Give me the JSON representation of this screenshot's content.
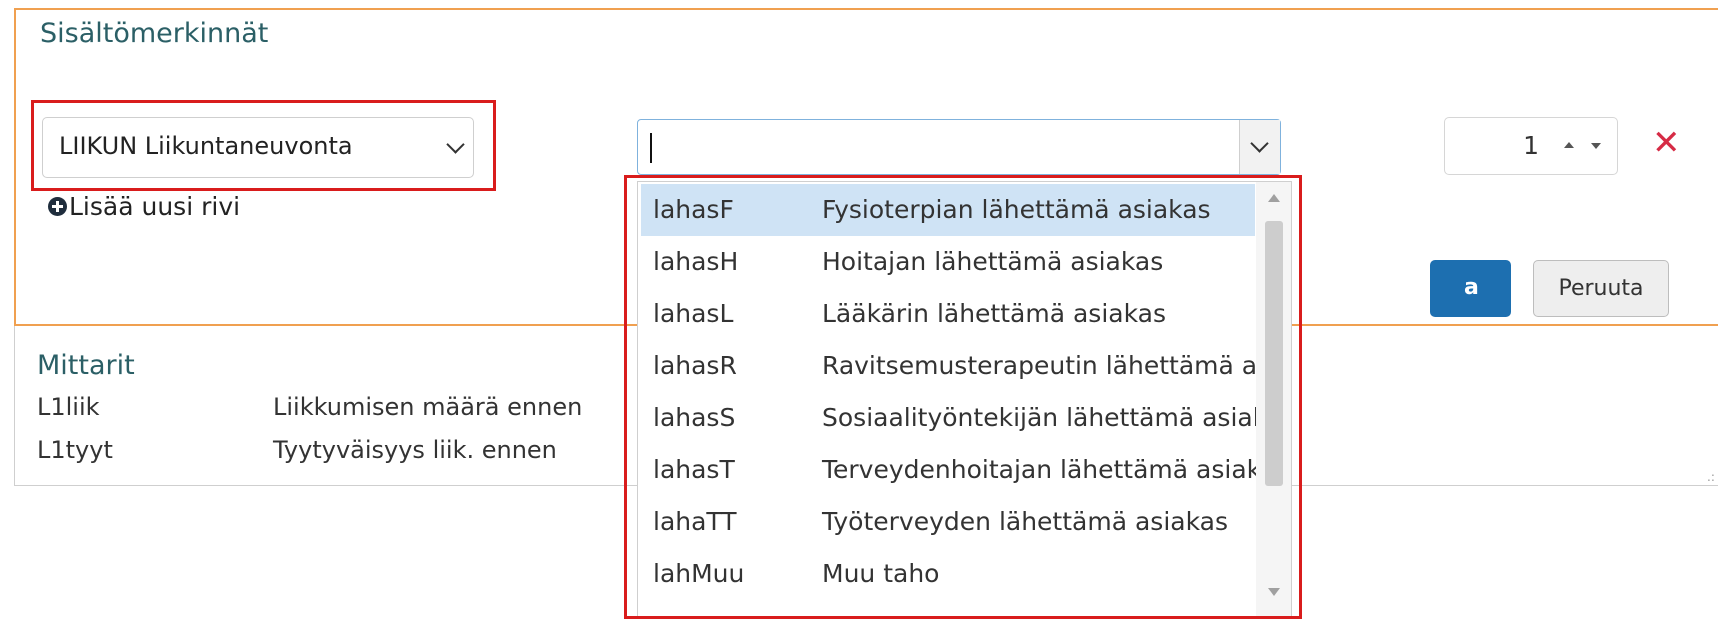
{
  "panel": {
    "title": "Sisältömerkinnät",
    "border_color": "#f0a050",
    "highlight_color": "#d91c1c"
  },
  "row": {
    "category_select": {
      "value": "LIIKUN Liikuntaneuvonta",
      "icon": "chevron-down-icon"
    },
    "code_combobox": {
      "value": "",
      "icon": "chevron-down-icon"
    },
    "quantity": {
      "value": "1"
    },
    "delete_icon": "close-icon",
    "delete_symbol": "✕",
    "delete_color": "#d62b45"
  },
  "add_row": {
    "label": "Lisää uusi rivi",
    "icon": "plus-circle-icon"
  },
  "buttons": {
    "save_visible_text": "a",
    "save_color": "#1d6fb0",
    "cancel": "Peruuta"
  },
  "mittarit": {
    "title": "Mittarit",
    "rows": [
      {
        "code": "L1liik",
        "desc": "Liikkumisen määrä ennen"
      },
      {
        "code": "L1tyyt",
        "desc": "Tyytyväisyys liik. ennen"
      }
    ]
  },
  "dropdown": {
    "selected_index": 0,
    "options": [
      {
        "code": "lahasF",
        "label": "Fysioterpian lähettämä asiakas"
      },
      {
        "code": "lahasH",
        "label": "Hoitajan lähettämä asiakas"
      },
      {
        "code": "lahasL",
        "label": "Lääkärin lähettämä asiakas"
      },
      {
        "code": "lahasR",
        "label": "Ravitsemusterapeutin lähettämä asiakas"
      },
      {
        "code": "lahasS",
        "label": "Sosiaalityöntekijän lähettämä asiakas"
      },
      {
        "code": "lahasT",
        "label": "Terveydenhoitajan lähettämä asiakas"
      },
      {
        "code": "lahaTT",
        "label": "Työterveyden lähettämä asiakas"
      },
      {
        "code": "lahMuu",
        "label": "Muu taho"
      }
    ]
  }
}
